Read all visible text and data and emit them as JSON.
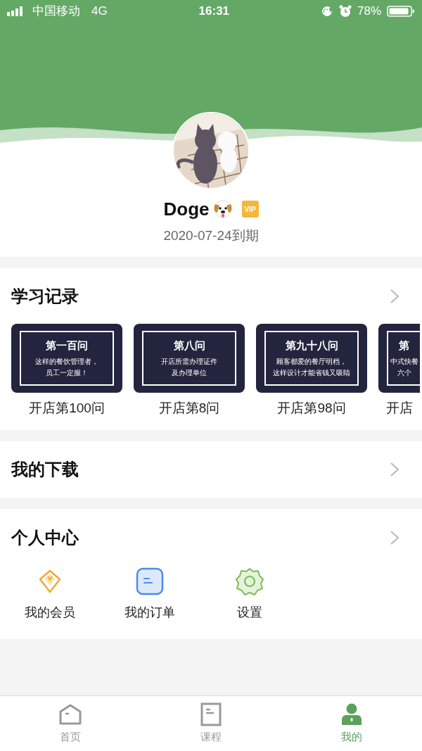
{
  "status_bar": {
    "carrier": "中国移动",
    "network": "4G",
    "time": "16:31",
    "battery": "78%"
  },
  "profile": {
    "name": "Doge",
    "vip_badge": "VIP",
    "expiry": "2020-07-24到期"
  },
  "study_records": {
    "title": "学习记录",
    "courses": [
      {
        "cover_title": "第一百问",
        "cover_lines": [
          "这样的餐饮管理者，",
          "员工一定服！"
        ],
        "label": "开店第100问"
      },
      {
        "cover_title": "第八问",
        "cover_lines": [
          "开店所需办理证件",
          "及办理单位"
        ],
        "label": "开店第8问"
      },
      {
        "cover_title": "第九十八问",
        "cover_lines": [
          "顾客都爱的餐厅明档，",
          "这样设计才能省钱又吸睛"
        ],
        "label": "开店第98问"
      },
      {
        "cover_title": "第",
        "cover_lines": [
          "中式快餐",
          "六个"
        ],
        "label": "开店"
      }
    ]
  },
  "downloads": {
    "title": "我的下载"
  },
  "personal_center": {
    "title": "个人中心",
    "items": [
      {
        "kind": "member",
        "label": "我的会员"
      },
      {
        "kind": "orders",
        "label": "我的订单"
      },
      {
        "kind": "settings",
        "label": "设置"
      }
    ]
  },
  "tab_bar": [
    {
      "kind": "home",
      "label": "首页",
      "selected": false
    },
    {
      "kind": "courses",
      "label": "课程",
      "selected": false
    },
    {
      "kind": "mine",
      "label": "我的",
      "selected": true
    }
  ]
}
